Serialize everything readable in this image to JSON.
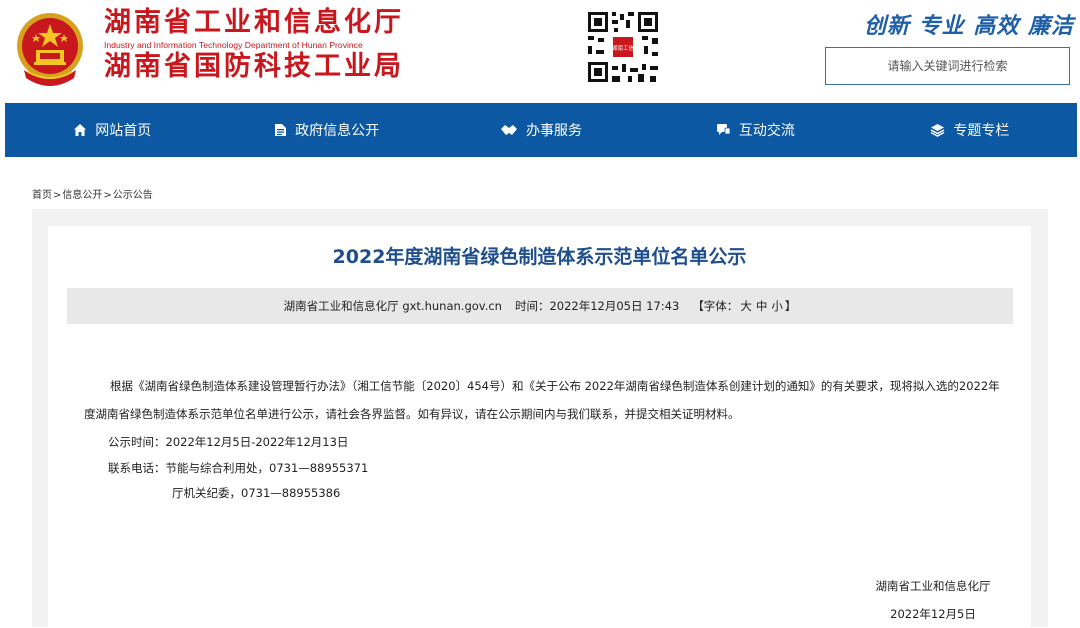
{
  "header": {
    "title_cn_1": "湖南省工业和信息化厅",
    "title_en": "Industry and Information Technology Department of Hunan Province",
    "title_cn_2": "湖南省国防科技工业局",
    "slogan": "创新 专业 高效 廉洁",
    "search_placeholder": "请输入关键词进行检索",
    "qr_caption": "湖南工信"
  },
  "nav": {
    "items": [
      {
        "label": "网站首页",
        "icon": "home-icon"
      },
      {
        "label": "政府信息公开",
        "icon": "document-icon"
      },
      {
        "label": "办事服务",
        "icon": "handshake-icon"
      },
      {
        "label": "互动交流",
        "icon": "chat-icon"
      },
      {
        "label": "专题专栏",
        "icon": "layers-icon"
      }
    ]
  },
  "breadcrumb": {
    "items": [
      "首页",
      "信息公开",
      "公示公告"
    ],
    "separator": ">"
  },
  "article": {
    "title": "2022年度湖南省绿色制造体系示范单位名单公示",
    "meta": {
      "source": "湖南省工业和信息化厅 gxt.hunan.gov.cn",
      "time_label": "时间：2022年12月05日 17:43",
      "font_label_open": "【字体：",
      "font_large": "大",
      "font_medium": "中",
      "font_small": "小",
      "font_label_close": "】"
    },
    "paragraph_1": "根据《湖南省绿色制造体系建设管理暂行办法》（湘工信节能〔2020〕454号）和《关于公布 2022年湖南省绿色制造体系创建计划的通知》的有关要求，现将拟入选的2022年度湖南省绿色制造体系示范单位名单进行公示，请社会各界监督。如有异议，请在公示期间内与我们联系，并提交相关证明材料。",
    "period": "公示时间：2022年12月5日-2022年12月13日",
    "contact_1": "联系电话：节能与综合利用处，0731—88955371",
    "contact_2": "厅机关纪委，0731—88955386",
    "signature_org": "湖南省工业和信息化厅",
    "signature_date": "2022年12月5日"
  },
  "colors": {
    "brand_red": "#c9171e",
    "nav_blue": "#0d58a2",
    "title_blue": "#1f4e8c",
    "slogan_blue": "#1f5fa8"
  }
}
